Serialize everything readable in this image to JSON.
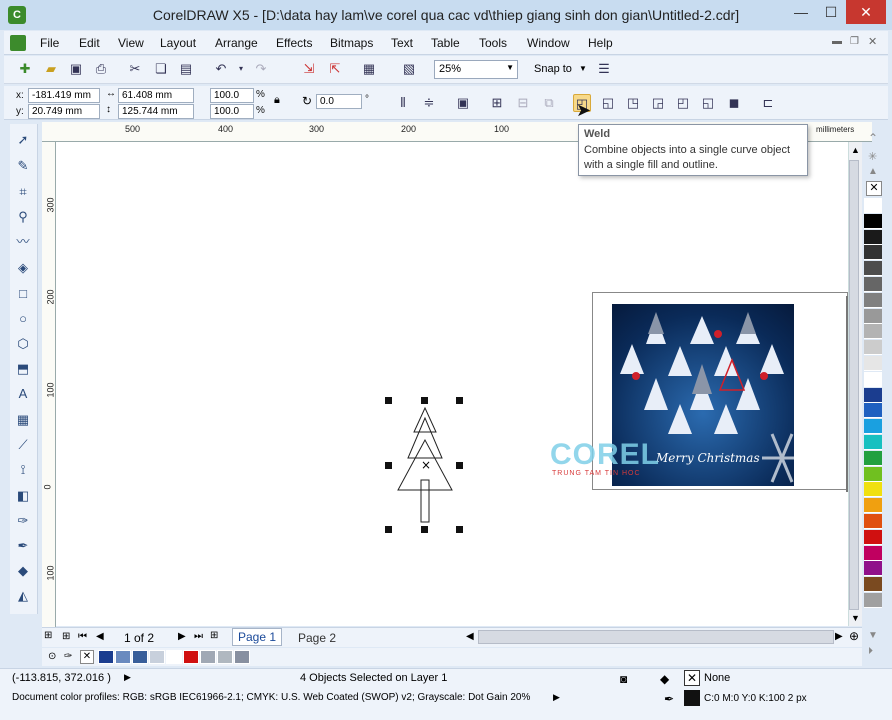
{
  "window": {
    "title": "CorelDRAW X5 - [D:\\data hay lam\\ve corel qua cac vd\\thiep giang sinh don gian\\Untitled-2.cdr]",
    "min": "—",
    "max": "☐",
    "close": "✕"
  },
  "menubar": {
    "items": [
      "File",
      "Edit",
      "View",
      "Layout",
      "Arrange",
      "Effects",
      "Bitmaps",
      "Text",
      "Table",
      "Tools",
      "Window",
      "Help"
    ]
  },
  "toolbar": {
    "zoom_value": "25%",
    "snap_label": "Snap to"
  },
  "propbar": {
    "x_label": "x:",
    "x_value": "-181.419 mm",
    "y_label": "y:",
    "y_value": "20.749 mm",
    "w_value": "61.408 mm",
    "h_value": "125.744 mm",
    "scale_w": "100.0",
    "scale_h": "100.0",
    "pct": "%",
    "rotation": "0.0",
    "deg": "°"
  },
  "ruler": {
    "h_labels": [
      "500",
      "400",
      "300",
      "200",
      "100"
    ],
    "v_labels": [
      "300",
      "200",
      "100",
      "0",
      "100"
    ],
    "units": "millimeters"
  },
  "tooltip": {
    "title": "Weld",
    "description": "Combine objects into a single curve object with a single fill and outline."
  },
  "artwork": {
    "logo_text": "COREL",
    "logo_sub": "TRUNG TAM TIN HOC",
    "card_text": "Merry Christmas"
  },
  "pagebar": {
    "page_counter": "1 of 2",
    "tabs": [
      "Page 1",
      "Page 2"
    ]
  },
  "status": {
    "coords": "(-113.815, 372.016 )",
    "selection": "4 Objects Selected on Layer 1",
    "profiles": "Document color profiles: RGB: sRGB IEC61966-2.1; CMYK: U.S. Web Coated (SWOP) v2; Grayscale: Dot Gain 20%",
    "fill": "None",
    "outline": "C:0 M:0 Y:0 K:100  2 px"
  },
  "colors": {
    "palette": [
      "#ffffff",
      "#000000",
      "#1a1a1a",
      "#333333",
      "#4d4d4d",
      "#666666",
      "#808080",
      "#999999",
      "#b3b3b3",
      "#cccccc",
      "#e6e6e6",
      "#ffffff",
      "#1b3d8f",
      "#2060c0",
      "#1aa0e0",
      "#17c0c0",
      "#22a040",
      "#70c020",
      "#f0e010",
      "#f0a010",
      "#e05010",
      "#d01010",
      "#c00060",
      "#90108a",
      "#7a4a20",
      "#a0a0a0"
    ],
    "doc_palette": [
      "#1b3d8f",
      "#6a8abf",
      "#3a5f9a",
      "#c8d0dc",
      "#ffffff",
      "#d01010",
      "#a0a8b4",
      "#b0b8c0",
      "#8890a0"
    ]
  }
}
